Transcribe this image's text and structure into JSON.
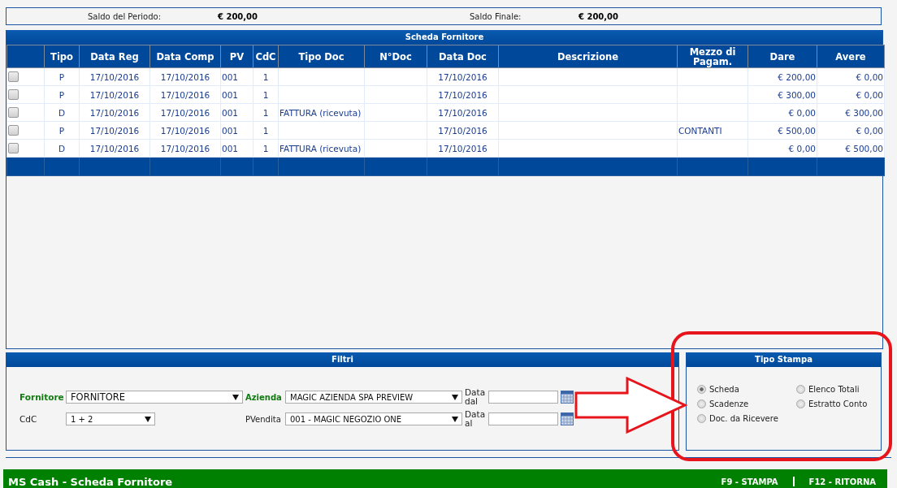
{
  "summary": [
    {
      "label": "Saldo del Periodo:",
      "value": "€ 200,00"
    },
    {
      "label": "Saldo Finale:",
      "value": "€ 200,00"
    }
  ],
  "table": {
    "title": "Scheda Fornitore",
    "columns": [
      "Tipo",
      "Data Reg",
      "Data Comp",
      "PV",
      "CdC",
      "Tipo Doc",
      "N°Doc",
      "Data Doc",
      "Descrizione",
      "Mezzo di Pagam.",
      "Dare",
      "Avere"
    ],
    "rows": [
      {
        "checked": false,
        "cells": [
          "P",
          "17/10/2016",
          "17/10/2016",
          "001",
          "1",
          "",
          "",
          "17/10/2016",
          "",
          "",
          "€ 200,00",
          "€ 0,00"
        ]
      },
      {
        "checked": false,
        "cells": [
          "P",
          "17/10/2016",
          "17/10/2016",
          "001",
          "1",
          "",
          "",
          "17/10/2016",
          "",
          "",
          "€ 300,00",
          "€ 0,00"
        ]
      },
      {
        "checked": false,
        "cells": [
          "D",
          "17/10/2016",
          "17/10/2016",
          "001",
          "1",
          "FATTURA (ricevuta)",
          "",
          "17/10/2016",
          "",
          "",
          "€ 0,00",
          "€ 300,00"
        ]
      },
      {
        "checked": false,
        "cells": [
          "P",
          "17/10/2016",
          "17/10/2016",
          "001",
          "1",
          "",
          "",
          "17/10/2016",
          "",
          "CONTANTI",
          "€ 500,00",
          "€ 0,00"
        ]
      },
      {
        "checked": false,
        "cells": [
          "D",
          "17/10/2016",
          "17/10/2016",
          "001",
          "1",
          "FATTURA (ricevuta)",
          "",
          "17/10/2016",
          "",
          "",
          "€ 0,00",
          "€ 500,00"
        ]
      }
    ]
  },
  "filters": {
    "title": "Filtri",
    "fornitore": {
      "label": "Fornitore",
      "value": "FORNITORE"
    },
    "azienda": {
      "label": "Azienda",
      "value": "MAGIC AZIENDA SPA PREVIEW"
    },
    "cdc": {
      "label": "CdC",
      "value": "1 + 2"
    },
    "pvendita": {
      "label": "PVendita",
      "value": "001 - MAGIC NEGOZIO ONE"
    },
    "data_dal": {
      "label": "Data dal"
    },
    "data_al": {
      "label": "Data al"
    }
  },
  "tipo_stampa": {
    "title": "Tipo Stampa",
    "options": [
      {
        "label": "Scheda",
        "selected": true
      },
      {
        "label": "Elenco Totali",
        "selected": false
      },
      {
        "label": "Scadenze",
        "selected": false
      },
      {
        "label": "Estratto Conto",
        "selected": false
      },
      {
        "label": "Doc. da Ricevere",
        "selected": false
      }
    ]
  },
  "status_bar": {
    "title": "MS Cash - Scheda Fornitore",
    "actions": [
      "F9 - STAMPA",
      "F12 - RITORNA"
    ]
  }
}
